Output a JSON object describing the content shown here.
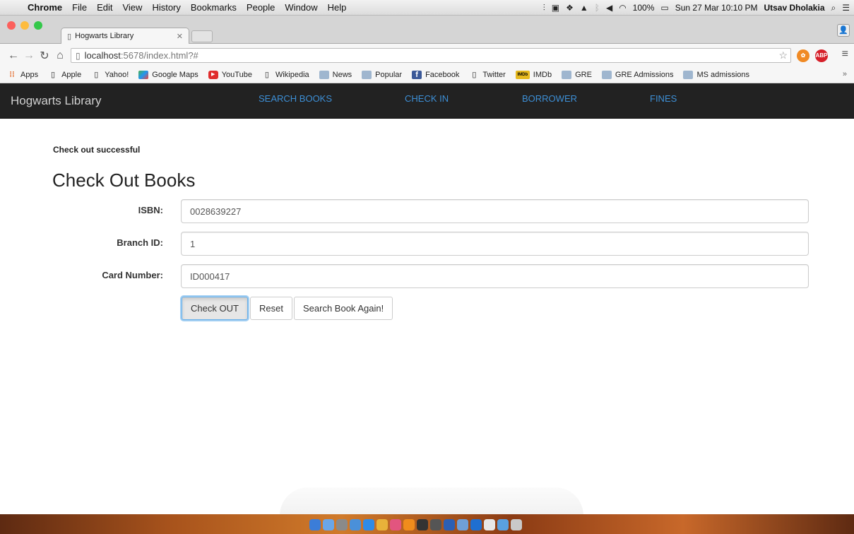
{
  "menubar": {
    "app": "Chrome",
    "items": [
      "File",
      "Edit",
      "View",
      "History",
      "Bookmarks",
      "People",
      "Window",
      "Help"
    ],
    "battery": "100%",
    "clock": "Sun 27 Mar  10:10 PM",
    "user": "Utsav Dholakia"
  },
  "browser": {
    "tab_title": "Hogwarts Library",
    "url_host": "localhost",
    "url_rest": ":5678/index.html?#",
    "bookmarks": [
      {
        "label": "Apps",
        "icon": "apps-grid"
      },
      {
        "label": "Apple",
        "icon": "page"
      },
      {
        "label": "Yahoo!",
        "icon": "page"
      },
      {
        "label": "Google Maps",
        "icon": "maps"
      },
      {
        "label": "YouTube",
        "icon": "youtube"
      },
      {
        "label": "Wikipedia",
        "icon": "page"
      },
      {
        "label": "News",
        "icon": "folder"
      },
      {
        "label": "Popular",
        "icon": "folder"
      },
      {
        "label": "Facebook",
        "icon": "facebook"
      },
      {
        "label": "Twitter",
        "icon": "page"
      },
      {
        "label": "IMDb",
        "icon": "imdb"
      },
      {
        "label": "GRE",
        "icon": "folder"
      },
      {
        "label": "GRE Admissions",
        "icon": "folder"
      },
      {
        "label": "MS admissions",
        "icon": "folder"
      }
    ]
  },
  "navbar": {
    "brand": "Hogwarts Library",
    "links": [
      "SEARCH BOOKS",
      "CHECK IN",
      "BORROWER",
      "FINES"
    ]
  },
  "page": {
    "status": "Check out successful",
    "heading": "Check Out Books",
    "fields": [
      {
        "label": "ISBN:",
        "value": "0028639227"
      },
      {
        "label": "Branch ID:",
        "value": "1"
      },
      {
        "label": "Card Number:",
        "value": "ID000417"
      }
    ],
    "buttons": {
      "checkout": "Check OUT",
      "reset": "Reset",
      "search_again": "Search Book Again!"
    }
  },
  "colors": {
    "navbar_bg": "#222222",
    "nav_link": "#3d8fd6",
    "focus_ring": "#66afe9"
  }
}
